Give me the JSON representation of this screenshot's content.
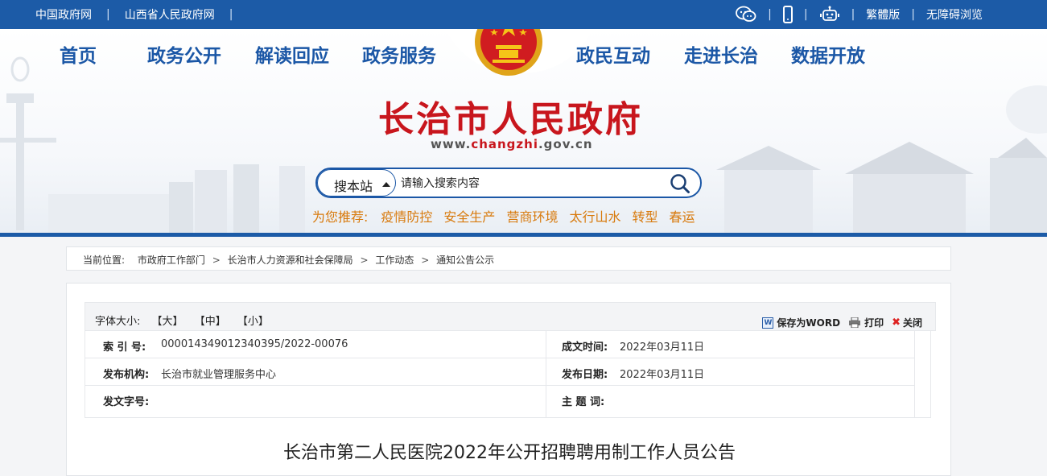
{
  "topbar": {
    "links": [
      "中国政府网",
      "山西省人民政府网"
    ],
    "traditional": "繁體版",
    "accessible": "无障碍浏览"
  },
  "nav": {
    "left": [
      "首页",
      "政务公开",
      "解读回应",
      "政务服务"
    ],
    "right": [
      "政民互动",
      "走进长治",
      "数据开放"
    ]
  },
  "site": {
    "title": "长治市人民政府",
    "url_prefix": "www.",
    "url_brand": "changzhi",
    "url_suffix": ".gov.cn"
  },
  "search": {
    "scope": "搜本站",
    "placeholder": "请输入搜索内容"
  },
  "recommend": {
    "label": "为您推荐:",
    "items": [
      "疫情防控",
      "安全生产",
      "营商环境",
      "太行山水",
      "转型",
      "春运"
    ]
  },
  "breadcrumb": {
    "label": "当前位置:",
    "items": [
      "市政府工作部门",
      "长治市人力资源和社会保障局",
      "工作动态",
      "通知公告公示"
    ]
  },
  "toolbar": {
    "fontsize_label": "字体大小:",
    "sizes": [
      "【大】",
      "【中】",
      "【小】"
    ],
    "save_word": "保存为WORD",
    "print": "打印",
    "close": "关闭"
  },
  "meta": {
    "index_label": "索 引 号:",
    "index_value": "000014349012340395/2022-00076",
    "created_label": "成文时间:",
    "created_value": "2022年03月11日",
    "publisher_label": "发布机构:",
    "publisher_value": "长治市就业管理服务中心",
    "published_label": "发布日期:",
    "published_value": "2022年03月11日",
    "docno_label": "发文字号:",
    "docno_value": "",
    "subject_label": "主 题 词:",
    "subject_value": ""
  },
  "article": {
    "title": "长治市第二人民医院2022年公开招聘聘用制工作人员公告"
  },
  "colors": {
    "brand_blue": "#1c5ba7",
    "title_red": "#c8161d",
    "recommend_orange": "#d87a0d"
  }
}
